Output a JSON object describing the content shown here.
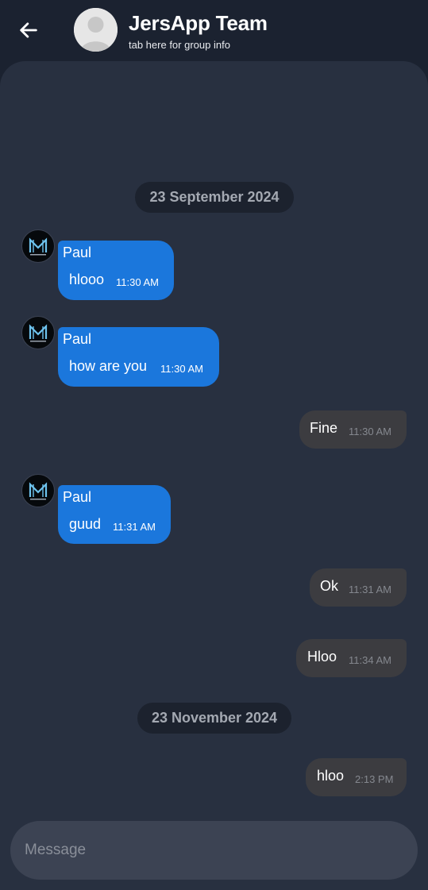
{
  "header": {
    "title": "JersApp Team",
    "subtitle": "tab here for group info",
    "back_icon": "arrow-left-icon",
    "avatar_icon": "default-user-avatar-icon"
  },
  "dates": [
    {
      "label": "23 September 2024"
    },
    {
      "label": "23 November 2024"
    }
  ],
  "messages": [
    {
      "direction": "incoming",
      "sender": "Paul",
      "text": "hlooo",
      "time": "11:30 AM"
    },
    {
      "direction": "incoming",
      "sender": "Paul",
      "text": "how are you",
      "time": "11:30 AM"
    },
    {
      "direction": "outgoing",
      "text": "Fine",
      "time": "11:30 AM"
    },
    {
      "direction": "incoming",
      "sender": "Paul",
      "text": "guud",
      "time": "11:31 AM"
    },
    {
      "direction": "outgoing",
      "text": "Ok",
      "time": "11:31 AM"
    },
    {
      "direction": "outgoing",
      "text": "Hloo",
      "time": "11:34 AM"
    },
    {
      "direction": "outgoing",
      "text": "hloo",
      "time": "2:13 PM"
    }
  ],
  "composer": {
    "placeholder": "Message"
  },
  "colors": {
    "header_bg": "#1b2230",
    "chat_bg": "#283040",
    "incoming_bubble": "#1b77dc",
    "outgoing_bubble": "#3c3c40",
    "date_chip_bg": "#1c222e",
    "date_chip_text": "#a4a9b2",
    "composer_bg": "#3c4353",
    "logo_accent": "#6ec3ee"
  }
}
